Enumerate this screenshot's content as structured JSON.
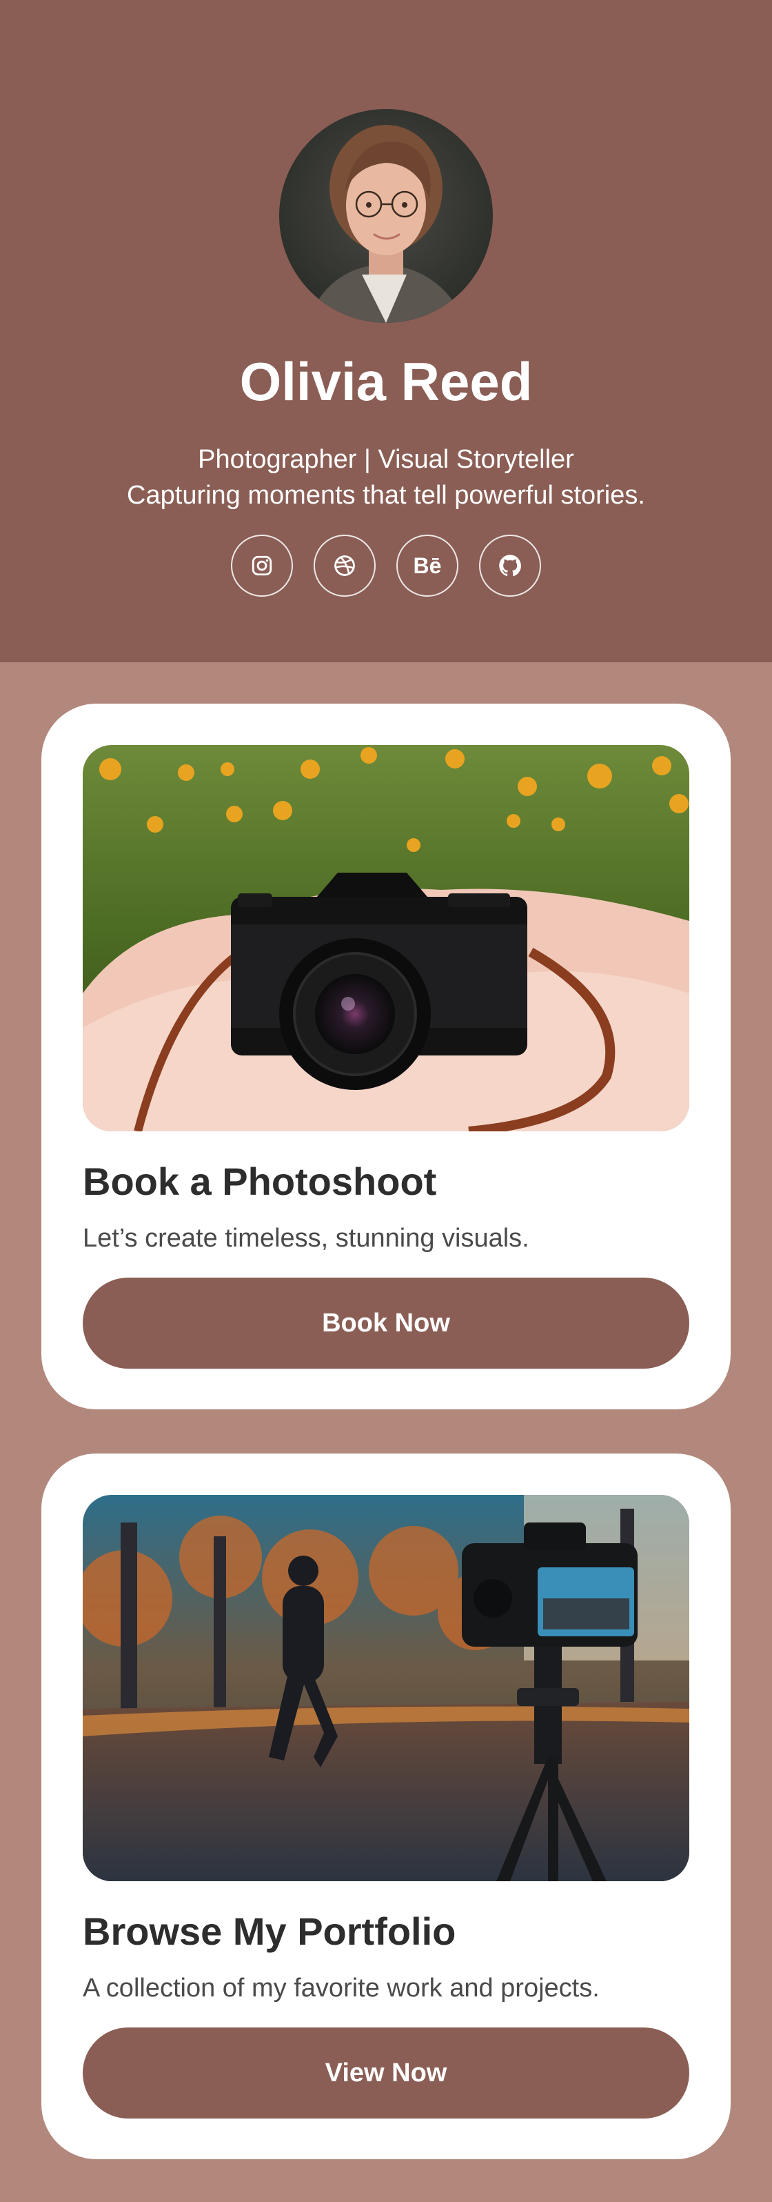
{
  "profile": {
    "name": "Olivia Reed",
    "role": "Photographer | Visual Storyteller",
    "tagline": "Capturing moments that tell powerful stories."
  },
  "socials": [
    {
      "icon": "instagram-icon"
    },
    {
      "icon": "dribbble-icon"
    },
    {
      "icon": "behance-icon",
      "label": "Bē"
    },
    {
      "icon": "github-icon"
    }
  ],
  "cards": [
    {
      "title": "Book a Photoshoot",
      "description": "Let’s create timeless, stunning visuals.",
      "button": "Book Now"
    },
    {
      "title": "Browse My Portfolio",
      "description": "A collection of my favorite work and projects.",
      "button": "View Now"
    }
  ],
  "colors": {
    "header_bg": "#8a5e55",
    "page_bg": "#b2887d",
    "button_bg": "#8a5e55",
    "card_bg": "#ffffff"
  }
}
